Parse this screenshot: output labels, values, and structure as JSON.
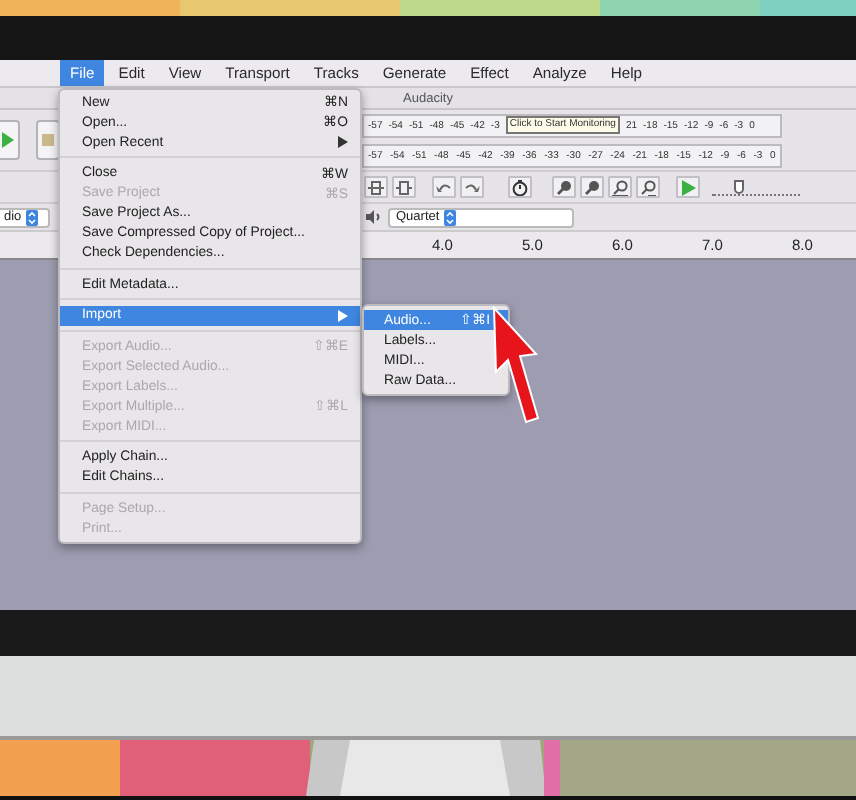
{
  "menubar": [
    {
      "label": "File",
      "selected": true
    },
    {
      "label": "Edit",
      "selected": false
    },
    {
      "label": "View",
      "selected": false
    },
    {
      "label": "Transport",
      "selected": false
    },
    {
      "label": "Tracks",
      "selected": false
    },
    {
      "label": "Generate",
      "selected": false
    },
    {
      "label": "Effect",
      "selected": false
    },
    {
      "label": "Analyze",
      "selected": false
    },
    {
      "label": "Help",
      "selected": false
    }
  ],
  "window": {
    "title": "Audacity"
  },
  "record_meter": {
    "scale_start": "-57 -54 -51 -48 -45 -42 -3",
    "tooltip": "Click to Start Monitoring",
    "scale_end": "21 -18 -15 -12 -9 -6 -3 0"
  },
  "playback_meter": {
    "scale": "-57 -54 -51 -48 -45 -42 -39 -36 -33 -30 -27 -24 -21 -18 -15 -12 -9 -6 -3 0"
  },
  "play_speed": {
    "level": 0.3
  },
  "input_device": "dio",
  "output_device": "Quartet",
  "ruler": [
    "4.0",
    "5.0",
    "6.0",
    "7.0",
    "8.0"
  ],
  "file_menu": {
    "sections": [
      {
        "items": [
          {
            "label": "New",
            "shortcut": "⌘N",
            "disabled": false,
            "submenu": false,
            "selected": false
          },
          {
            "label": "Open...",
            "shortcut": "⌘O",
            "disabled": false,
            "submenu": false,
            "selected": false
          },
          {
            "label": "Open Recent",
            "disabled": false,
            "submenu": true,
            "selected": false
          }
        ]
      },
      {
        "items": [
          {
            "label": "Close",
            "shortcut": "⌘W",
            "disabled": false,
            "submenu": false,
            "selected": false
          },
          {
            "label": "Save Project",
            "shortcut": "⌘S",
            "disabled": true,
            "submenu": false,
            "selected": false
          },
          {
            "label": "Save Project As...",
            "disabled": false,
            "submenu": false,
            "selected": false
          },
          {
            "label": "Save Compressed Copy of Project...",
            "disabled": false,
            "submenu": false,
            "selected": false
          },
          {
            "label": "Check Dependencies...",
            "disabled": false,
            "submenu": false,
            "selected": false
          }
        ]
      },
      {
        "items": [
          {
            "label": "Edit Metadata...",
            "disabled": false,
            "submenu": false,
            "selected": false
          }
        ]
      },
      {
        "items": [
          {
            "label": "Import",
            "disabled": false,
            "submenu": true,
            "selected": true
          }
        ]
      },
      {
        "items": [
          {
            "label": "Export Audio...",
            "shortcut": "⇧⌘E",
            "disabled": true,
            "submenu": false,
            "selected": false
          },
          {
            "label": "Export Selected Audio...",
            "disabled": true,
            "submenu": false,
            "selected": false
          },
          {
            "label": "Export Labels...",
            "disabled": true,
            "submenu": false,
            "selected": false
          },
          {
            "label": "Export Multiple...",
            "shortcut": "⇧⌘L",
            "disabled": true,
            "submenu": false,
            "selected": false
          },
          {
            "label": "Export MIDI...",
            "disabled": true,
            "submenu": false,
            "selected": false
          }
        ]
      },
      {
        "items": [
          {
            "label": "Apply Chain...",
            "disabled": false,
            "submenu": false,
            "selected": false
          },
          {
            "label": "Edit Chains...",
            "disabled": false,
            "submenu": false,
            "selected": false
          }
        ]
      },
      {
        "items": [
          {
            "label": "Page Setup...",
            "disabled": true,
            "submenu": false,
            "selected": false
          },
          {
            "label": "Print...",
            "disabled": true,
            "submenu": false,
            "selected": false
          }
        ]
      }
    ]
  },
  "import_submenu": {
    "items": [
      {
        "label": "Audio...",
        "shortcut": "⇧⌘I",
        "selected": true
      },
      {
        "label": "Labels...",
        "selected": false
      },
      {
        "label": "MIDI...",
        "selected": false
      },
      {
        "label": "Raw Data...",
        "selected": false
      }
    ]
  }
}
